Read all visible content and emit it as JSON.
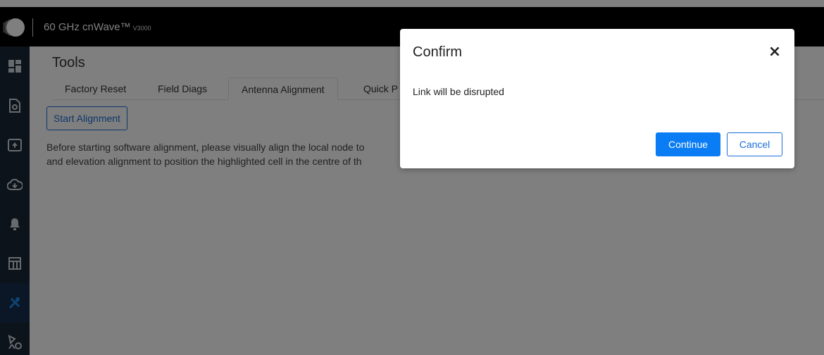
{
  "header": {
    "app_title": "60 GHz cnWave™",
    "version": "V3000"
  },
  "sidebar": {
    "items": [
      {
        "icon": "dashboard-icon",
        "label": "Dashboard"
      },
      {
        "icon": "configuration-icon",
        "label": "Configuration"
      },
      {
        "icon": "software-upgrade-icon",
        "label": "Software Upgrade"
      },
      {
        "icon": "cloud-icon",
        "label": "Cloud"
      },
      {
        "icon": "alarm-bell-icon",
        "label": "Alarms"
      },
      {
        "icon": "table-icon",
        "label": "Statistics"
      },
      {
        "icon": "tools-icon",
        "label": "Tools",
        "active": true
      },
      {
        "icon": "antenna-icon",
        "label": "Antenna"
      }
    ]
  },
  "main": {
    "title": "Tools",
    "tabs": [
      {
        "label": "Factory Reset"
      },
      {
        "label": "Field Diags"
      },
      {
        "label": "Antenna Alignment",
        "active": true
      },
      {
        "label": "Quick P"
      }
    ],
    "start_button": "Start Alignment",
    "description_line1": "Before starting software alignment, please visually align the local node to",
    "description_line2": "and elevation alignment to position the highlighted cell in the centre of th"
  },
  "modal": {
    "title": "Confirm",
    "close_symbol": "×",
    "body": "Link will be disrupted",
    "continue_label": "Continue",
    "cancel_label": "Cancel"
  },
  "colors": {
    "topbar": "#000000",
    "sidebar": "#1b2735",
    "primary": "#0a7cf4",
    "tools_active": "#1e88e5"
  }
}
